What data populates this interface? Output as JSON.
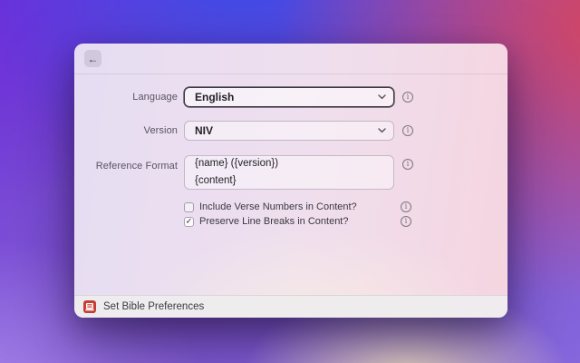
{
  "header": {
    "back_icon": "←"
  },
  "form": {
    "language": {
      "label": "Language",
      "value": "English",
      "focused": true
    },
    "version": {
      "label": "Version",
      "value": "NIV",
      "focused": false
    },
    "reference_format": {
      "label": "Reference Format",
      "line1": "{name} ({version})",
      "line2": "{content}"
    },
    "include_verse_numbers": {
      "label": "Include Verse Numbers in Content?",
      "checked": false
    },
    "preserve_line_breaks": {
      "label": "Preserve Line Breaks in Content?",
      "checked": true
    }
  },
  "icons": {
    "back": "←",
    "info": "i",
    "check": "✓",
    "chevron_down": "⌄"
  },
  "footer": {
    "title": "Set Bible Preferences"
  },
  "colors": {
    "app_icon_red": "#c63d33",
    "bg_violet": "#6d2cda",
    "bg_blue": "#3d4be8",
    "bg_crimson": "#d5455e",
    "bg_warm_glow": "#f8e8c3"
  }
}
